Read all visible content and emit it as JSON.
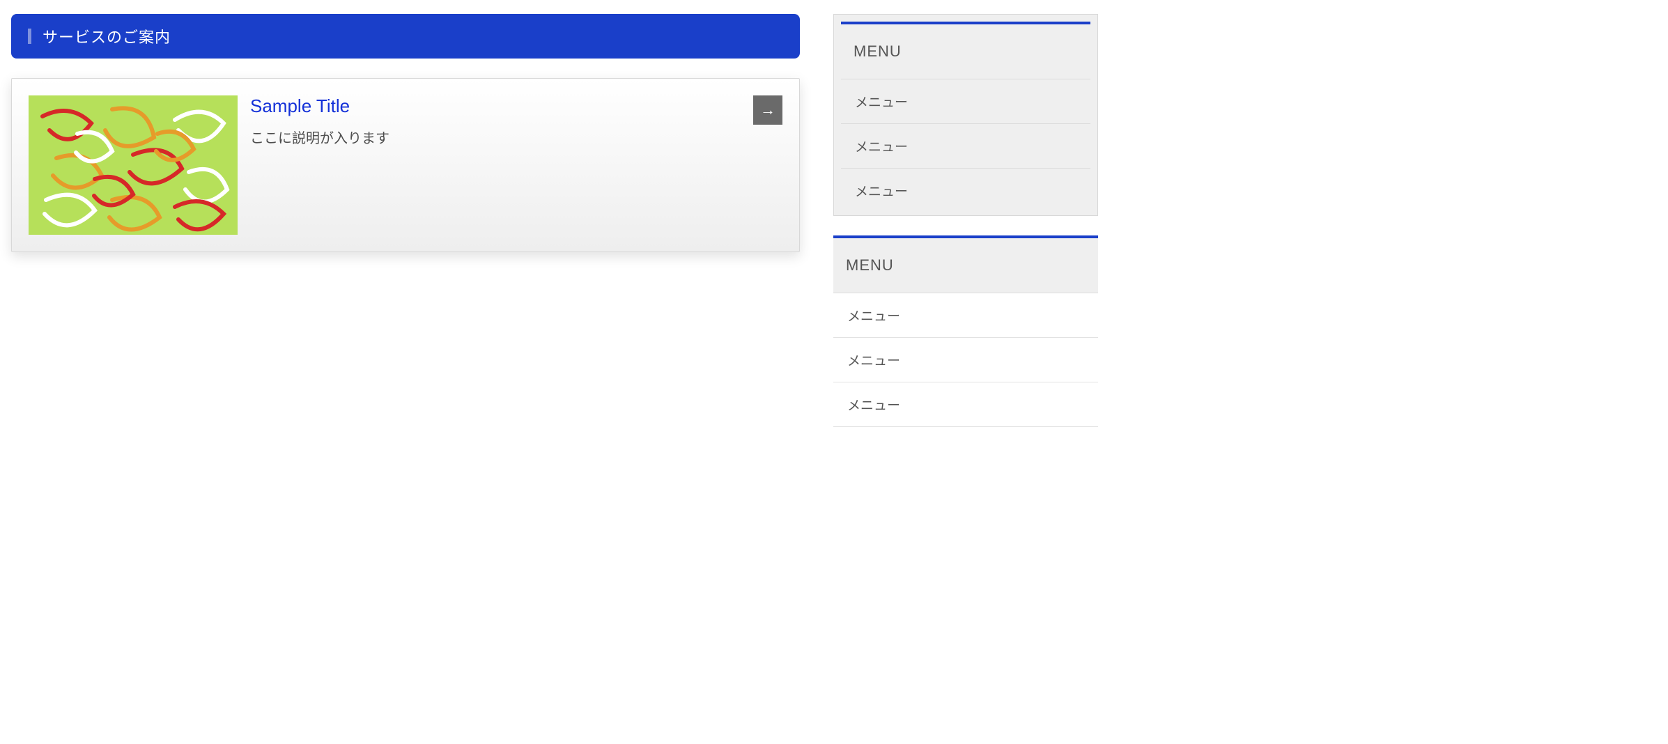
{
  "section": {
    "title": "サービスのご案内"
  },
  "card": {
    "title": "Sample Title",
    "description": "ここに説明が入ります",
    "arrow_glyph": "→"
  },
  "sidebar": {
    "widgets": [
      {
        "title": "MENU",
        "items": [
          "メニュー",
          "メニュー",
          "メニュー"
        ]
      },
      {
        "title": "MENU",
        "items": [
          "メニュー",
          "メニュー",
          "メニュー"
        ]
      }
    ]
  }
}
